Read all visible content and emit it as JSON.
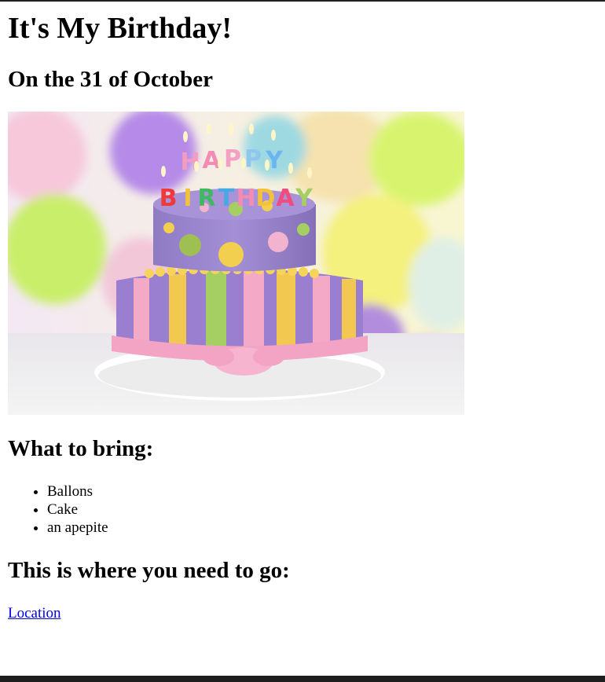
{
  "page": {
    "title": "It's My Birthday!",
    "date_heading": "On the 31 of October",
    "image": {
      "description_label": "HAPPY BIRTHDAY",
      "letters_top": "HAPPY",
      "letters_bottom": "BIRTHDAY"
    },
    "bring_heading": "What to bring:",
    "bring_items": [
      "Ballons",
      "Cake",
      "an apepite"
    ],
    "go_heading": "This is where you need to go:",
    "location_link": "Location"
  },
  "colors": {
    "link": "#0000ee",
    "text": "#000000",
    "background": "#ffffff"
  }
}
